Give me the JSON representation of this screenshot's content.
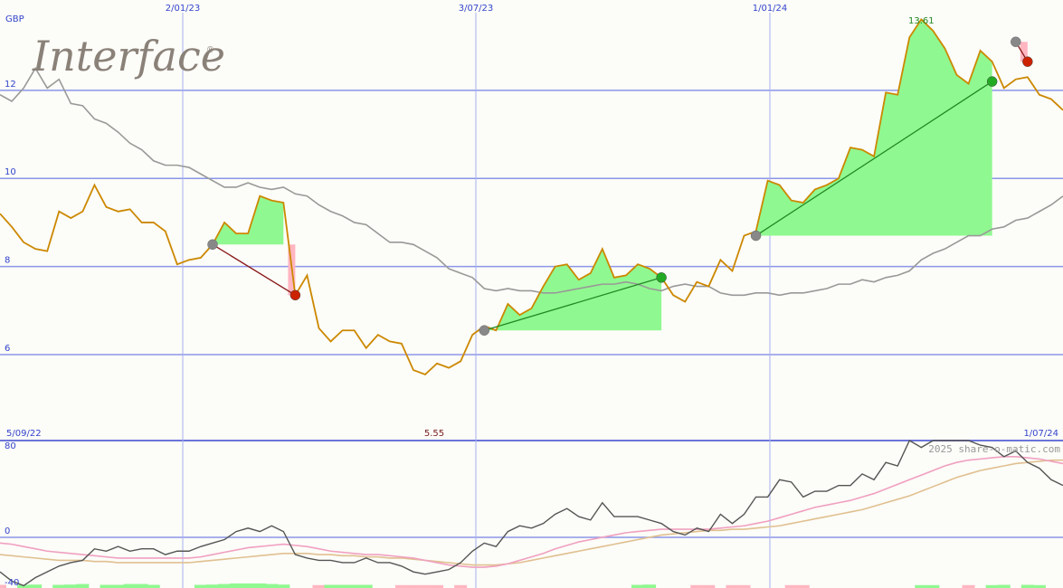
{
  "chart_data": [
    {
      "type": "line",
      "currency": "GBP",
      "logo_text": "Interface",
      "logo_mark": "®",
      "date_start": "5/09/22",
      "date_end": "1/07/24",
      "top_date_labels": [
        "2/01/23",
        "3/07/23",
        "1/01/24"
      ],
      "y_ticks": [
        6,
        8,
        10,
        12
      ],
      "ylim": [
        4.05,
        14.05
      ],
      "min_label": "5.55",
      "max_label": "13.61",
      "grid": true,
      "colors": {
        "price": "#cc8800",
        "moving_average": "#999999",
        "gain_fill": "#90f890",
        "loss_fill": "#ffb6c1",
        "gain_line": "#228822",
        "loss_line": "#881818",
        "entry_marker": "#888888",
        "exit_gain_marker": "#22aa22",
        "exit_loss_marker": "#cc2200"
      },
      "price": [
        9.2,
        8.9,
        8.55,
        8.4,
        8.35,
        9.25,
        9.1,
        9.25,
        9.85,
        9.35,
        9.25,
        9.3,
        9.0,
        9.0,
        8.8,
        8.05,
        8.15,
        8.2,
        8.5,
        9.0,
        8.75,
        8.75,
        9.6,
        9.5,
        9.45,
        7.35,
        7.8,
        6.6,
        6.3,
        6.55,
        6.55,
        6.15,
        6.45,
        6.3,
        6.25,
        5.65,
        5.55,
        5.8,
        5.7,
        5.85,
        6.45,
        6.65,
        6.55,
        7.15,
        6.9,
        7.05,
        7.55,
        8.0,
        8.05,
        7.7,
        7.85,
        8.4,
        7.75,
        7.8,
        8.05,
        7.95,
        7.75,
        7.35,
        7.2,
        7.65,
        7.55,
        8.15,
        7.9,
        8.7,
        8.8,
        9.95,
        9.85,
        9.5,
        9.45,
        9.75,
        9.85,
        10.0,
        10.7,
        10.65,
        10.5,
        11.95,
        11.9,
        13.2,
        13.61,
        13.35,
        12.95,
        12.35,
        12.15,
        12.9,
        12.65,
        12.05,
        12.25,
        12.3,
        11.9,
        11.8,
        11.55
      ],
      "moving_average": [
        11.9,
        11.75,
        12.05,
        12.5,
        12.05,
        12.25,
        11.7,
        11.65,
        11.35,
        11.25,
        11.05,
        10.8,
        10.65,
        10.4,
        10.3,
        10.3,
        10.25,
        10.1,
        9.95,
        9.8,
        9.8,
        9.9,
        9.8,
        9.75,
        9.8,
        9.65,
        9.6,
        9.4,
        9.25,
        9.15,
        9.0,
        8.95,
        8.75,
        8.55,
        8.55,
        8.5,
        8.35,
        8.2,
        7.95,
        7.85,
        7.75,
        7.5,
        7.45,
        7.5,
        7.45,
        7.45,
        7.4,
        7.4,
        7.45,
        7.5,
        7.55,
        7.6,
        7.6,
        7.65,
        7.6,
        7.5,
        7.45,
        7.55,
        7.6,
        7.55,
        7.55,
        7.4,
        7.35,
        7.35,
        7.4,
        7.4,
        7.35,
        7.4,
        7.4,
        7.45,
        7.5,
        7.6,
        7.6,
        7.7,
        7.65,
        7.75,
        7.8,
        7.9,
        8.15,
        8.3,
        8.4,
        8.55,
        8.7,
        8.7,
        8.85,
        8.9,
        9.05,
        9.1,
        9.25,
        9.4,
        9.6
      ],
      "trades": [
        {
          "entry_index": 18,
          "exit_index": 25,
          "entry": 8.5,
          "exit": 7.35,
          "result": "loss"
        },
        {
          "entry_index": 41,
          "exit_index": 56,
          "entry": 6.55,
          "exit": 7.75,
          "result": "gain"
        },
        {
          "entry_index": 64,
          "exit_index": 84,
          "entry": 8.7,
          "exit": 12.2,
          "result": "gain"
        },
        {
          "entry_index": 86,
          "exit_index": 87,
          "entry": 13.1,
          "exit": 12.65,
          "result": "loss"
        }
      ]
    },
    {
      "type": "line",
      "watermark": "2025 share-o-matic.com",
      "y_ticks": [
        -40,
        0,
        80
      ],
      "ylim": [
        -44,
        84
      ],
      "grid": true,
      "colors": {
        "oscillator": "#555555",
        "signal_fast": "#f0a0c0",
        "signal_slow": "#e0c090",
        "hist_positive": "#90f890",
        "hist_negative": "#ffb6c1"
      },
      "oscillator": [
        -30,
        -38,
        -42,
        -35,
        -30,
        -25,
        -22,
        -20,
        -10,
        -12,
        -8,
        -12,
        -10,
        -10,
        -15,
        -12,
        -12,
        -8,
        -5,
        -2,
        5,
        8,
        5,
        10,
        5,
        -15,
        -18,
        -20,
        -20,
        -22,
        -22,
        -18,
        -22,
        -22,
        -25,
        -30,
        -32,
        -30,
        -28,
        -22,
        -12,
        -5,
        -8,
        5,
        10,
        8,
        12,
        20,
        25,
        18,
        15,
        30,
        18,
        18,
        18,
        15,
        12,
        5,
        2,
        8,
        5,
        20,
        12,
        20,
        35,
        35,
        50,
        48,
        35,
        40,
        40,
        45,
        45,
        55,
        50,
        65,
        62,
        85,
        78,
        85,
        100,
        92,
        85,
        80,
        78,
        70,
        75,
        65,
        60,
        50,
        45
      ],
      "signal_fast": [
        -5,
        -6,
        -8,
        -10,
        -12,
        -13,
        -14,
        -15,
        -16,
        -17,
        -18,
        -18,
        -18,
        -18,
        -18,
        -18,
        -18,
        -17,
        -15,
        -13,
        -11,
        -9,
        -8,
        -7,
        -6,
        -7,
        -8,
        -10,
        -12,
        -13,
        -14,
        -15,
        -15,
        -16,
        -17,
        -18,
        -20,
        -22,
        -24,
        -25,
        -26,
        -26,
        -25,
        -23,
        -20,
        -17,
        -14,
        -10,
        -7,
        -4,
        -2,
        0,
        2,
        4,
        5,
        6,
        7,
        7,
        7,
        7,
        7,
        8,
        9,
        10,
        12,
        14,
        17,
        20,
        23,
        26,
        28,
        30,
        32,
        35,
        38,
        42,
        46,
        50,
        54,
        58,
        62,
        65,
        67,
        68,
        69,
        70,
        70,
        69,
        68,
        66,
        64
      ],
      "signal_slow": [
        -15,
        -16,
        -17,
        -18,
        -19,
        -20,
        -20,
        -20,
        -21,
        -21,
        -22,
        -22,
        -22,
        -22,
        -22,
        -22,
        -22,
        -21,
        -20,
        -19,
        -18,
        -17,
        -16,
        -15,
        -14,
        -14,
        -14,
        -15,
        -15,
        -16,
        -16,
        -17,
        -17,
        -18,
        -18,
        -19,
        -20,
        -21,
        -22,
        -23,
        -24,
        -24,
        -24,
        -23,
        -22,
        -20,
        -18,
        -16,
        -14,
        -12,
        -10,
        -8,
        -6,
        -4,
        -2,
        0,
        2,
        3,
        4,
        5,
        6,
        6,
        7,
        7,
        8,
        9,
        10,
        12,
        14,
        16,
        18,
        20,
        22,
        24,
        27,
        30,
        33,
        36,
        40,
        44,
        48,
        52,
        55,
        58,
        60,
        62,
        64,
        65,
        66,
        67,
        67
      ],
      "histogram_sign": [
        -1,
        0,
        1,
        1,
        0,
        1,
        1,
        1,
        0,
        1,
        1,
        1,
        1,
        1,
        0,
        0,
        0,
        1,
        1,
        1,
        1,
        1,
        1,
        1,
        1,
        0,
        0,
        -1,
        1,
        1,
        1,
        1,
        0,
        0,
        -1,
        -1,
        -1,
        -1,
        0,
        -1,
        0,
        0,
        0,
        0,
        0,
        0,
        0,
        0,
        0,
        0,
        0,
        0,
        0,
        0,
        1,
        1,
        0,
        0,
        0,
        -1,
        -1,
        0,
        -1,
        -1,
        0,
        0,
        0,
        -1,
        -1,
        0,
        0,
        0,
        0,
        0,
        0,
        0,
        0,
        0,
        1,
        1,
        0,
        0,
        -1,
        0,
        1,
        1,
        0,
        1,
        1,
        0,
        0
      ],
      "histogram_magnitude": [
        0.5,
        0,
        0.5,
        0.6,
        0,
        0.5,
        0.6,
        0.8,
        0,
        0.5,
        0.5,
        0.8,
        0.8,
        0.5,
        0,
        0,
        0,
        0.5,
        0.6,
        0.8,
        1.0,
        1.0,
        1.0,
        0.8,
        0.6,
        0,
        0,
        0.4,
        0.5,
        0.5,
        0.5,
        0.5,
        0,
        0,
        0.4,
        0.4,
        0.4,
        0.4,
        0,
        0.4,
        0,
        0,
        0,
        0,
        0,
        0,
        0,
        0,
        0,
        0,
        0,
        0,
        0,
        0,
        0.5,
        0.6,
        0,
        0,
        0,
        0.4,
        0.4,
        0,
        0.4,
        0.4,
        0,
        0,
        0,
        0.4,
        0.4,
        0,
        0,
        0,
        0,
        0,
        0,
        0,
        0,
        0,
        0.4,
        0.4,
        0,
        0,
        0.4,
        0,
        0.4,
        0.5,
        0,
        0.5,
        0.4,
        0,
        0
      ]
    }
  ]
}
